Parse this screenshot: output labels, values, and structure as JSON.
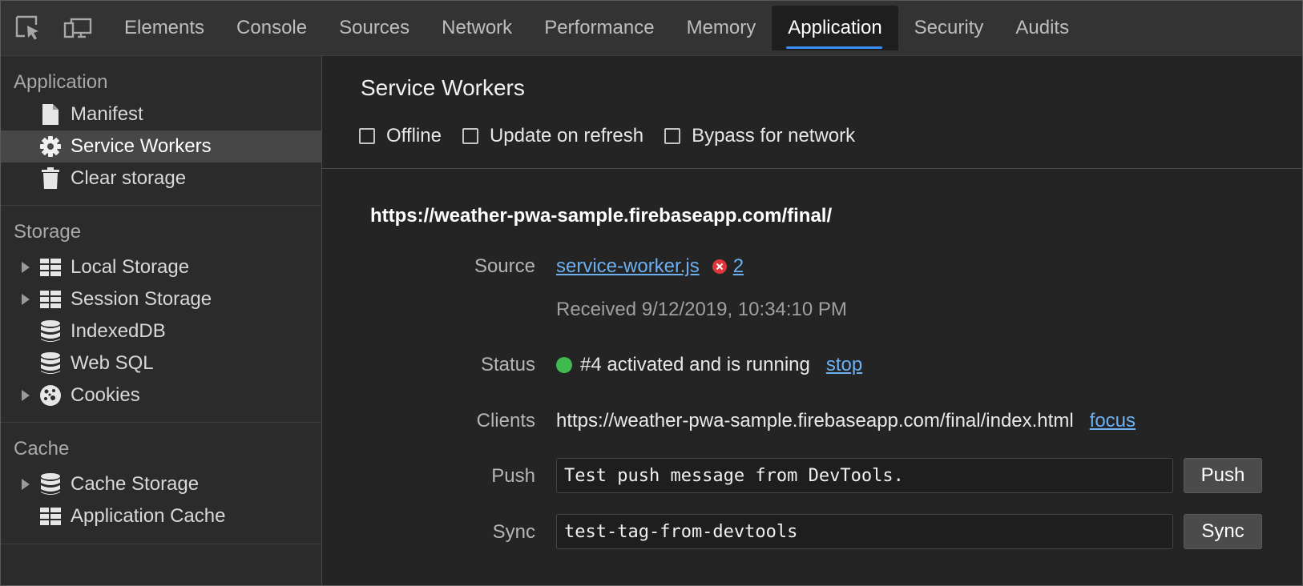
{
  "toolbar": {
    "inspect_icon": "inspect-element-icon",
    "device_icon": "device-toolbar-icon",
    "tabs": [
      {
        "label": "Elements"
      },
      {
        "label": "Console"
      },
      {
        "label": "Sources"
      },
      {
        "label": "Network"
      },
      {
        "label": "Performance"
      },
      {
        "label": "Memory"
      },
      {
        "label": "Application",
        "active": true
      },
      {
        "label": "Security"
      },
      {
        "label": "Audits"
      }
    ]
  },
  "sidebar": {
    "application": {
      "title": "Application",
      "items": [
        {
          "label": "Manifest",
          "icon": "document-icon"
        },
        {
          "label": "Service Workers",
          "icon": "gear-icon",
          "selected": true
        },
        {
          "label": "Clear storage",
          "icon": "trash-icon"
        }
      ]
    },
    "storage": {
      "title": "Storage",
      "items": [
        {
          "label": "Local Storage",
          "icon": "grid-icon",
          "expandable": true
        },
        {
          "label": "Session Storage",
          "icon": "grid-icon",
          "expandable": true
        },
        {
          "label": "IndexedDB",
          "icon": "database-icon"
        },
        {
          "label": "Web SQL",
          "icon": "database-icon"
        },
        {
          "label": "Cookies",
          "icon": "cookie-icon",
          "expandable": true
        }
      ]
    },
    "cache": {
      "title": "Cache",
      "items": [
        {
          "label": "Cache Storage",
          "icon": "database-icon",
          "expandable": true
        },
        {
          "label": "Application Cache",
          "icon": "grid-icon"
        }
      ]
    }
  },
  "main": {
    "title": "Service Workers",
    "checkboxes": [
      {
        "label": "Offline",
        "checked": false
      },
      {
        "label": "Update on refresh",
        "checked": false
      },
      {
        "label": "Bypass for network",
        "checked": false
      }
    ],
    "origin": "https://weather-pwa-sample.firebaseapp.com/final/",
    "source": {
      "label": "Source",
      "file": "service-worker.js",
      "error_count": "2",
      "received": "Received 9/12/2019, 10:34:10 PM"
    },
    "status": {
      "label": "Status",
      "text": "#4 activated and is running",
      "action": "stop",
      "color": "#3fb950"
    },
    "clients": {
      "label": "Clients",
      "url": "https://weather-pwa-sample.firebaseapp.com/final/index.html",
      "action": "focus"
    },
    "push": {
      "label": "Push",
      "value": "Test push message from DevTools.",
      "button": "Push"
    },
    "sync": {
      "label": "Sync",
      "value": "test-tag-from-devtools",
      "button": "Sync"
    }
  },
  "colors": {
    "accent": "#3d8ef2",
    "link": "#6cb0f2",
    "error": "#e0353b"
  }
}
